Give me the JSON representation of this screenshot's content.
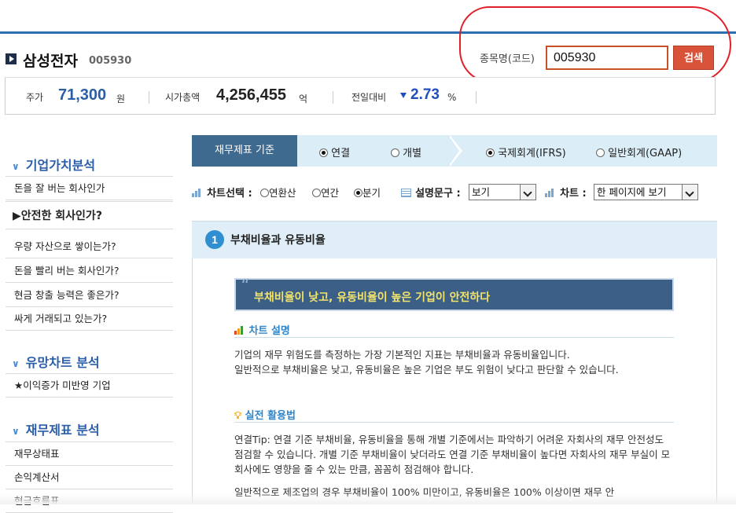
{
  "header": {
    "stock_name": "삼성전자",
    "stock_code": "005930",
    "search_label": "종목명(코드)",
    "search_value": "005930",
    "search_button": "검색"
  },
  "summary": {
    "price_label": "주가",
    "price_value": "71,300",
    "price_unit": "원",
    "marketcap_label": "시가총액",
    "marketcap_value": "4,256,455",
    "marketcap_unit": "억",
    "change_label": "전일대비",
    "change_value": "2.73",
    "change_unit": "%",
    "change_color": "#1f4fbf"
  },
  "sidebar": {
    "section1_title": "기업가치분석",
    "section1_items": [
      "돈을 잘 버는 회사인가",
      "안전한 회사인가?",
      "우량 자산으로 쌓이는가?",
      "돈을 빨리 버는 회사인가?",
      "현금 창출 능력은 좋은가?",
      "싸게 거래되고 있는가?"
    ],
    "section2_title": "유망차트 분석",
    "section2_items": [
      "★이익증가 미반영 기업"
    ],
    "section3_title": "재무제표 분석",
    "section3_items": [
      "재무상태표",
      "손익계산서",
      "현금흐름표"
    ]
  },
  "tabs": {
    "basis_label": "재무제표 기준",
    "consolidated": "연결",
    "separate": "개별",
    "ifrs": "국제회계(IFRS)",
    "gaap": "일반회계(GAAP)"
  },
  "controls": {
    "chart_select_label": "차트선택 :",
    "opt_annual_conv": "연환산",
    "opt_annual": "연간",
    "opt_quarter": "분기",
    "desc_label": "설명문구 :",
    "desc_value": "보기",
    "chart_label": "차트 :",
    "chart_value": "한 페이지에 보기"
  },
  "section": {
    "number": "1",
    "title": "부채비율과 유동비율",
    "quote": "부채비율이 낮고, 유동비율이 높은 기업이 안전하다",
    "chart_desc_title": "차트 설명",
    "chart_desc_line1": "기업의 재무 위험도를 측정하는 가장 기본적인 지표는 부채비율과 유동비율입니다.",
    "chart_desc_line2": "일반적으로 부채비율은 낮고, 유동비율은 높은 기업은 부도 위험이 낮다고 판단할 수 있습니다.",
    "practical_title": "실전 활용법",
    "practical_para1": "연결Tip: 연결 기준 부채비율, 유동비율을 통해 개별 기준에서는 파악하기 어려운 자회사의 재무 안전성도 점검할 수 있습니다. 개별 기준 부채비율이 낮더라도 연결 기준 부채비율이 높다면 자회사의 재무 부실이 모회사에도 영향을 줄 수 있는 만큼, 꼼꼼히 점검해야 합니다.",
    "practical_para2": "일반적으로 제조업의 경우 부채비율이 100% 미만이고, 유동비율은 100% 이상이면 재무 안"
  },
  "colors": {
    "accent_blue": "#2a5ea8",
    "search_button": "#d9533a",
    "annotation_red": "#e0202a",
    "tab_dark": "#3f6a8f",
    "quote_text": "#f2e36a"
  }
}
